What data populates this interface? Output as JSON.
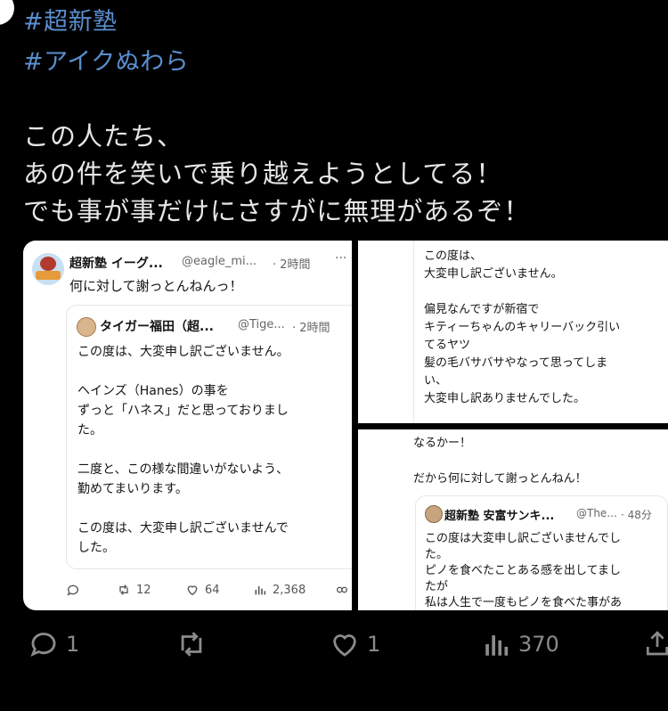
{
  "tweet": {
    "hashtags": [
      "#超新塾",
      "#アイクぬわら"
    ],
    "body_lines": [
      "この人たち、",
      "あの件を笑いで乗り越えようとしてる！",
      "でも事が事だけにさすがに無理があるぞ！"
    ]
  },
  "embedded_left": {
    "author": "超新塾 イーグ...",
    "handle": "@eagle_mi...",
    "time": "· 2時間",
    "more": "···",
    "text": "何に対して謝っとんねんっ！",
    "quote": {
      "author": "タイガー福田（超...",
      "handle": "@Tige...",
      "time": "· 2時間",
      "lines": [
        "この度は、大変申し訳ございません。",
        "",
        "ヘインズ（Hanes）の事を",
        "ずっと「ハネス」だと思っておりまし",
        "た。",
        "",
        "二度と、この様な間違いがないよう、",
        "勤めてまいります。",
        "",
        "この度は、大変申し訳ございませんで",
        "した。"
      ]
    },
    "stats": {
      "retweets": "12",
      "likes": "64",
      "views": "2,368"
    }
  },
  "embedded_top_right": {
    "lines": [
      "この度は、",
      "大変申し訳ございません。",
      "",
      "偏見なんですが新宿で",
      "キティーちゃんのキャリーバック引い",
      "てるヤツ",
      "髪の毛バサバサやなって思ってしま",
      "い、",
      "大変申し訳ありませんでした。"
    ]
  },
  "embedded_bottom_right": {
    "lines": [
      "なるかー！",
      "",
      "だから何に対して謝っとんねん！"
    ],
    "quote": {
      "author": "超新塾 安富サンキ...",
      "handle": "@The...",
      "time": "· 48分",
      "lines": [
        "この度は大変申し訳ございませんでし",
        "た。",
        "ピノを食べたことある感を出してまし",
        "たが",
        "私は人生で一度もピノを食べた事があ"
      ]
    }
  },
  "action_bar": {
    "replies": "1",
    "likes": "1",
    "views": "370"
  },
  "colors": {
    "background": "#000000",
    "hashtag": "#5a8fd0",
    "text": "#e6e6e6",
    "icon": "#8b8b8b"
  }
}
